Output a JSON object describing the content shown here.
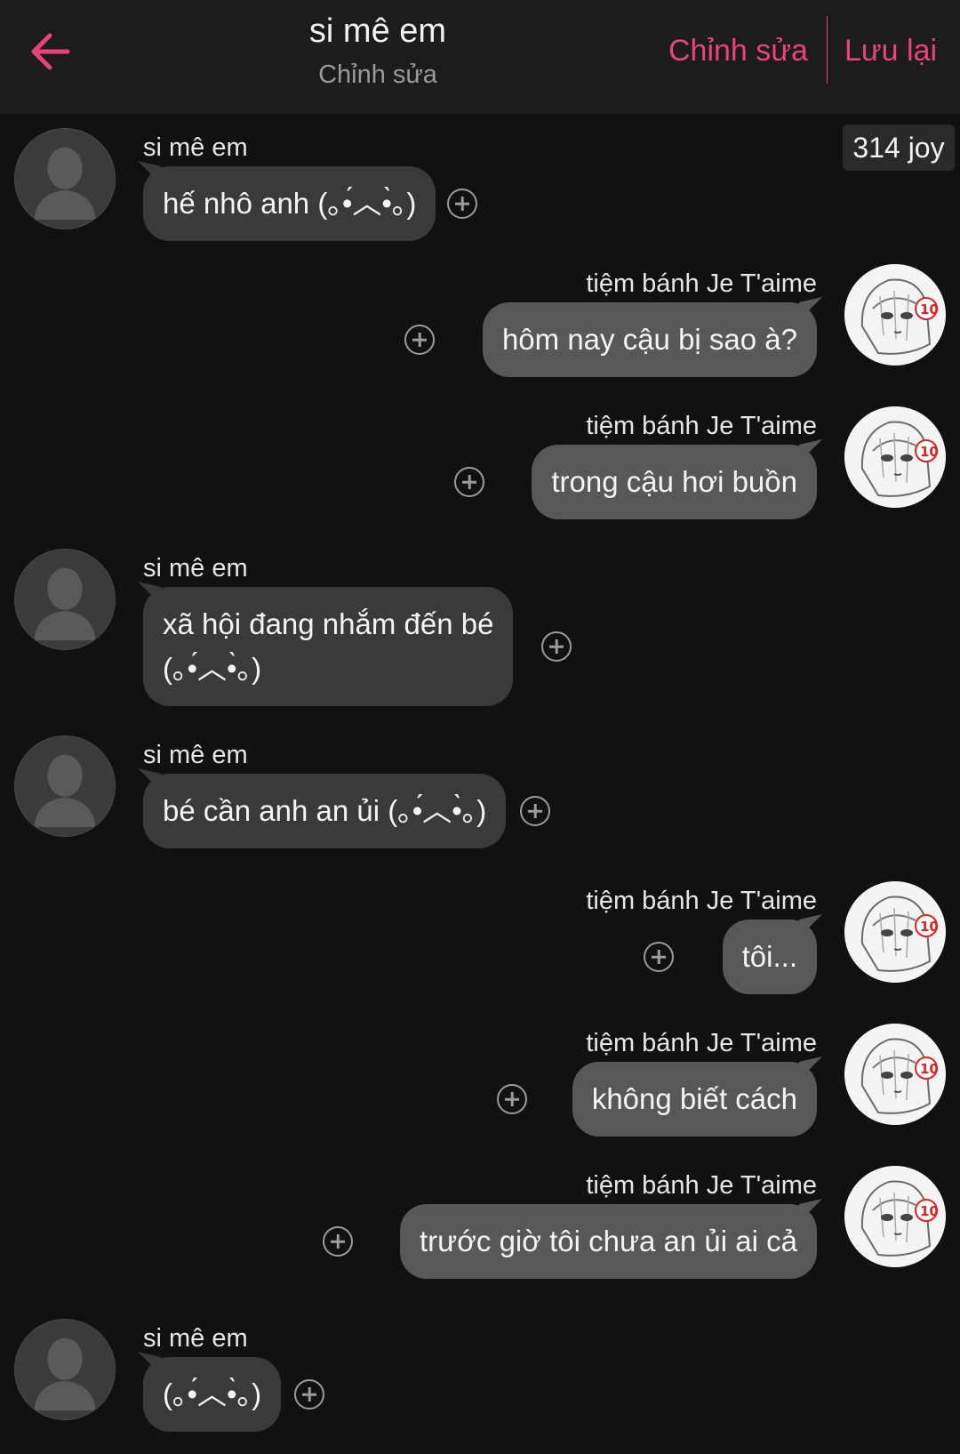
{
  "header": {
    "title": "si mê em",
    "subtitle": "Chỉnh sửa",
    "edit_label": "Chỉnh sửa",
    "save_label": "Lưu lại",
    "accent_color": "#e8437d"
  },
  "joy_badge": "314 joy",
  "icons": {
    "back": "arrow-left-icon",
    "add_reaction": "plus-circle-icon",
    "avatar_default": "person-silhouette-icon",
    "avatar_manga": "manga-character-avatar"
  },
  "messages": [
    {
      "side": "left",
      "sender": "si mê em",
      "lines": [
        "hế nhô anh (｡•́︿•̀｡)"
      ]
    },
    {
      "side": "right",
      "sender": "tiệm bánh Je T'aime",
      "lines": [
        "hôm nay cậu bị sao à?"
      ]
    },
    {
      "side": "right",
      "sender": "tiệm bánh Je T'aime",
      "lines": [
        "trong cậu hơi buồn"
      ]
    },
    {
      "side": "left",
      "sender": "si mê em",
      "lines": [
        "xã hội đang nhắm đến bé",
        "(｡•́︿•̀｡)"
      ]
    },
    {
      "side": "left",
      "sender": "si mê em",
      "lines": [
        "bé cần anh an ủi (｡•́︿•̀｡)"
      ]
    },
    {
      "side": "right",
      "sender": "tiệm bánh Je T'aime",
      "lines": [
        "tôi..."
      ]
    },
    {
      "side": "right",
      "sender": "tiệm bánh Je T'aime",
      "lines": [
        "không biết cách"
      ]
    },
    {
      "side": "right",
      "sender": "tiệm bánh Je T'aime",
      "lines": [
        "trước giờ tôi chưa an ủi ai cả"
      ]
    },
    {
      "side": "left",
      "sender": "si mê em",
      "lines": [
        "(｡•́︿•̀｡)"
      ]
    }
  ]
}
